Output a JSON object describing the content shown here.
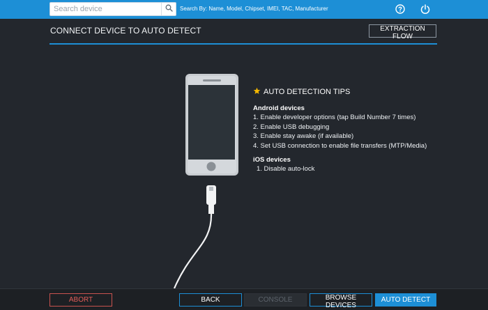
{
  "search": {
    "placeholder": "Search device",
    "hint": "Search By: Name, Model, Chipset, IMEI, TAC, Manufacturer"
  },
  "header": {
    "title": "CONNECT DEVICE TO AUTO DETECT",
    "extraction_flow_label": "EXTRACTION FLOW"
  },
  "icons": {
    "search": "search-icon",
    "help": "help-icon",
    "power": "power-icon",
    "star": "star-icon"
  },
  "tips": {
    "heading": "AUTO DETECTION TIPS",
    "android": {
      "title": "Android devices",
      "items": [
        "1. Enable developer options (tap Build Number 7 times)",
        "2. Enable USB debugging",
        "3. Enable stay awake (if available)",
        "4. Set USB connection to enable file transfers (MTP/Media)"
      ]
    },
    "ios": {
      "title": "iOS devices",
      "items": [
        "1. Disable auto-lock"
      ]
    }
  },
  "footer": {
    "abort": "ABORT",
    "back": "BACK",
    "console": "CONSOLE",
    "browse_devices": "BROWSE DEVICES",
    "auto_detect": "AUTO DETECT"
  },
  "colors": {
    "accent": "#1d8fd6",
    "background": "#23272d",
    "abort": "#e25c58",
    "star": "#f5b800"
  }
}
